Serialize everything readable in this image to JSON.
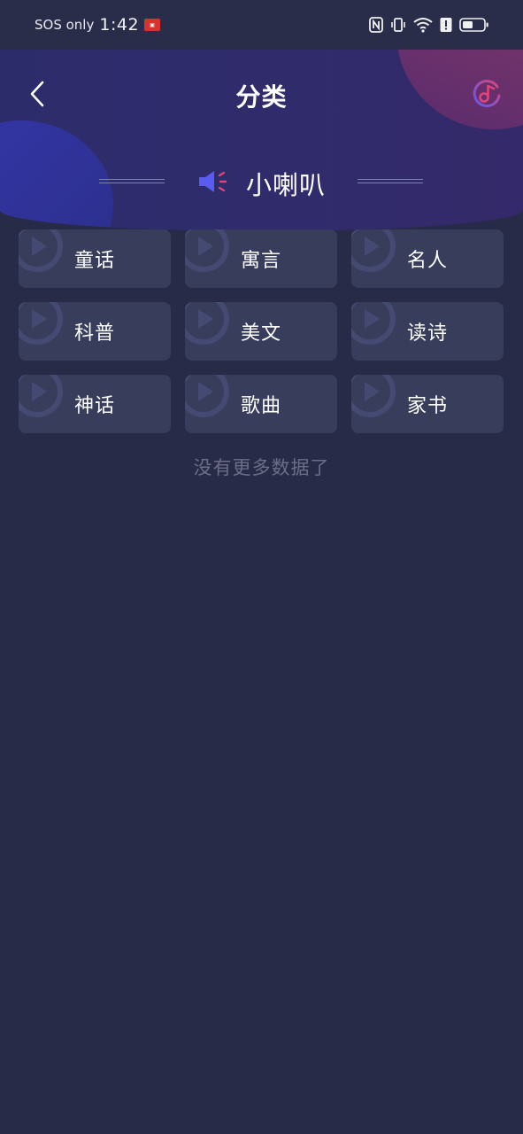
{
  "status_bar": {
    "carrier": "SOS only",
    "time": "1:42",
    "icons": [
      "nfc-icon",
      "vibrate-icon",
      "wifi-icon",
      "alert-icon",
      "battery-icon"
    ]
  },
  "nav": {
    "back_icon": "chevron-left-icon",
    "title": "分类",
    "music_icon": "music-note-icon"
  },
  "section": {
    "icon": "speaker-icon",
    "title": "小喇叭"
  },
  "categories": [
    {
      "label": "童话"
    },
    {
      "label": "寓言"
    },
    {
      "label": "名人"
    },
    {
      "label": "科普"
    },
    {
      "label": "美文"
    },
    {
      "label": "读诗"
    },
    {
      "label": "神话"
    },
    {
      "label": "歌曲"
    },
    {
      "label": "家书"
    }
  ],
  "footer": {
    "no_more_text": "没有更多数据了"
  },
  "colors": {
    "background": "#282b48",
    "card": "#393d5c",
    "header": "#2e2c6c",
    "accent_blue": "#5a5cf0",
    "accent_pink": "#e0447a",
    "muted_text": "#6c6e88"
  }
}
